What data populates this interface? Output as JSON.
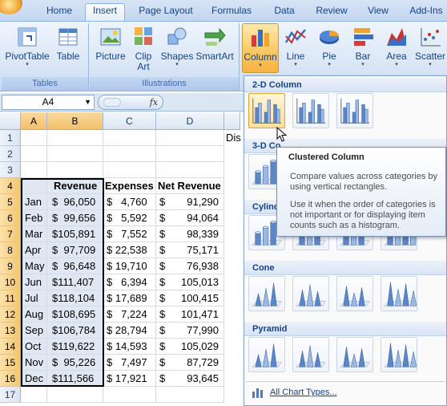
{
  "tabs": [
    "Home",
    "Insert",
    "Page Layout",
    "Formulas",
    "Data",
    "Review",
    "View",
    "Add-Ins"
  ],
  "active_tab": "Insert",
  "ribbon": {
    "pivottable": "PivotTable",
    "table": "Table",
    "tables_group": "Tables",
    "picture": "Picture",
    "clip_art_1": "Clip",
    "clip_art_2": "Art",
    "shapes": "Shapes",
    "smartart": "SmartArt",
    "illustrations_group": "Illustrations",
    "column": "Column",
    "line": "Line",
    "pie": "Pie",
    "bar": "Bar",
    "area": "Area",
    "scatter": "Scatter"
  },
  "formula_bar": {
    "name_box": "A4",
    "fx": "fx"
  },
  "columns": [
    "A",
    "B",
    "C",
    "D"
  ],
  "rows": [
    "1",
    "2",
    "3",
    "4",
    "5",
    "6",
    "7",
    "8",
    "9",
    "10",
    "11",
    "12",
    "13",
    "14",
    "15",
    "16",
    "17"
  ],
  "d1_partial": "Dis",
  "headers": {
    "revenue": "Revenue",
    "expenses": "Expenses",
    "net_revenue": "Net Revenue"
  },
  "months": [
    "Jan",
    "Feb",
    "Mar",
    "Apr",
    "May",
    "Jun",
    "Jul",
    "Aug",
    "Sep",
    "Oct",
    "Nov",
    "Dec"
  ],
  "revenue": [
    "$  96,050",
    "$  99,656",
    "$105,891",
    "$  97,709",
    "$  96,648",
    "$111,407",
    "$118,104",
    "$108,695",
    "$106,784",
    "$119,622",
    "$  95,226",
    "$111,566"
  ],
  "expenses": [
    "$   4,760",
    "$   5,592",
    "$   7,552",
    "$ 22,538",
    "$ 19,710",
    "$   6,394",
    "$ 17,689",
    "$   7,224",
    "$ 28,794",
    "$ 14,593",
    "$   7,497",
    "$ 17,921"
  ],
  "net_revenue": [
    "91,290",
    "94,064",
    "98,339",
    "75,171",
    "76,938",
    "105,013",
    "100,415",
    "101,471",
    "77,990",
    "105,029",
    "87,729",
    "93,645"
  ],
  "currency": "$",
  "gallery": {
    "sec_2d": "2-D Column",
    "sec_3d": "3-D Co",
    "sec_cyl": "Cylind",
    "sec_cone": "Cone",
    "sec_pyr": "Pyramid",
    "all_types": "All Chart Types..."
  },
  "tooltip": {
    "title": "Clustered Column",
    "body1": "Compare values across categories by using vertical rectangles.",
    "body2": "Use it when the order of categories is not important or for displaying item counts such as a histogram."
  },
  "colors": {
    "accent": "#15428b",
    "selection": "#f9d99f",
    "ribbon": "#dbe7f7"
  }
}
